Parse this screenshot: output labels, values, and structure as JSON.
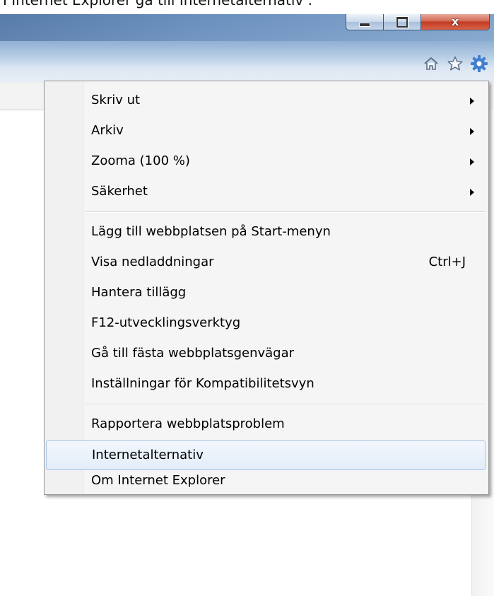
{
  "caption": "I Internet Explorer gå till Internetalternativ .",
  "window_buttons": {
    "minimize": "–",
    "maximize": "□",
    "close": "x"
  },
  "toolbar": {
    "icons": [
      "home-icon",
      "favorites-star-icon",
      "tools-gear-icon"
    ]
  },
  "menu": {
    "group1": [
      {
        "label": "Skriv ut",
        "submenu": true
      },
      {
        "label": "Arkiv",
        "submenu": true
      },
      {
        "label": "Zooma (100 %)",
        "submenu": true
      },
      {
        "label": "Säkerhet",
        "submenu": true
      }
    ],
    "group2": [
      {
        "label": "Lägg till webbplatsen på Start-menyn"
      },
      {
        "label": "Visa nedladdningar",
        "shortcut": "Ctrl+J"
      },
      {
        "label": "Hantera tillägg"
      },
      {
        "label": "F12-utvecklingsverktyg"
      },
      {
        "label": "Gå till fästa webbplatsgenvägar"
      },
      {
        "label": "Inställningar för Kompatibilitetsvyn"
      }
    ],
    "group3": [
      {
        "label": "Rapportera webbplatsproblem"
      },
      {
        "label": "Internetalternativ",
        "highlighted": true
      },
      {
        "label": "Om Internet Explorer"
      }
    ]
  },
  "colors": {
    "highlight_border": "#a9c5e7",
    "gear_blue": "#3f7fcf",
    "close_red": "#c23b21"
  }
}
